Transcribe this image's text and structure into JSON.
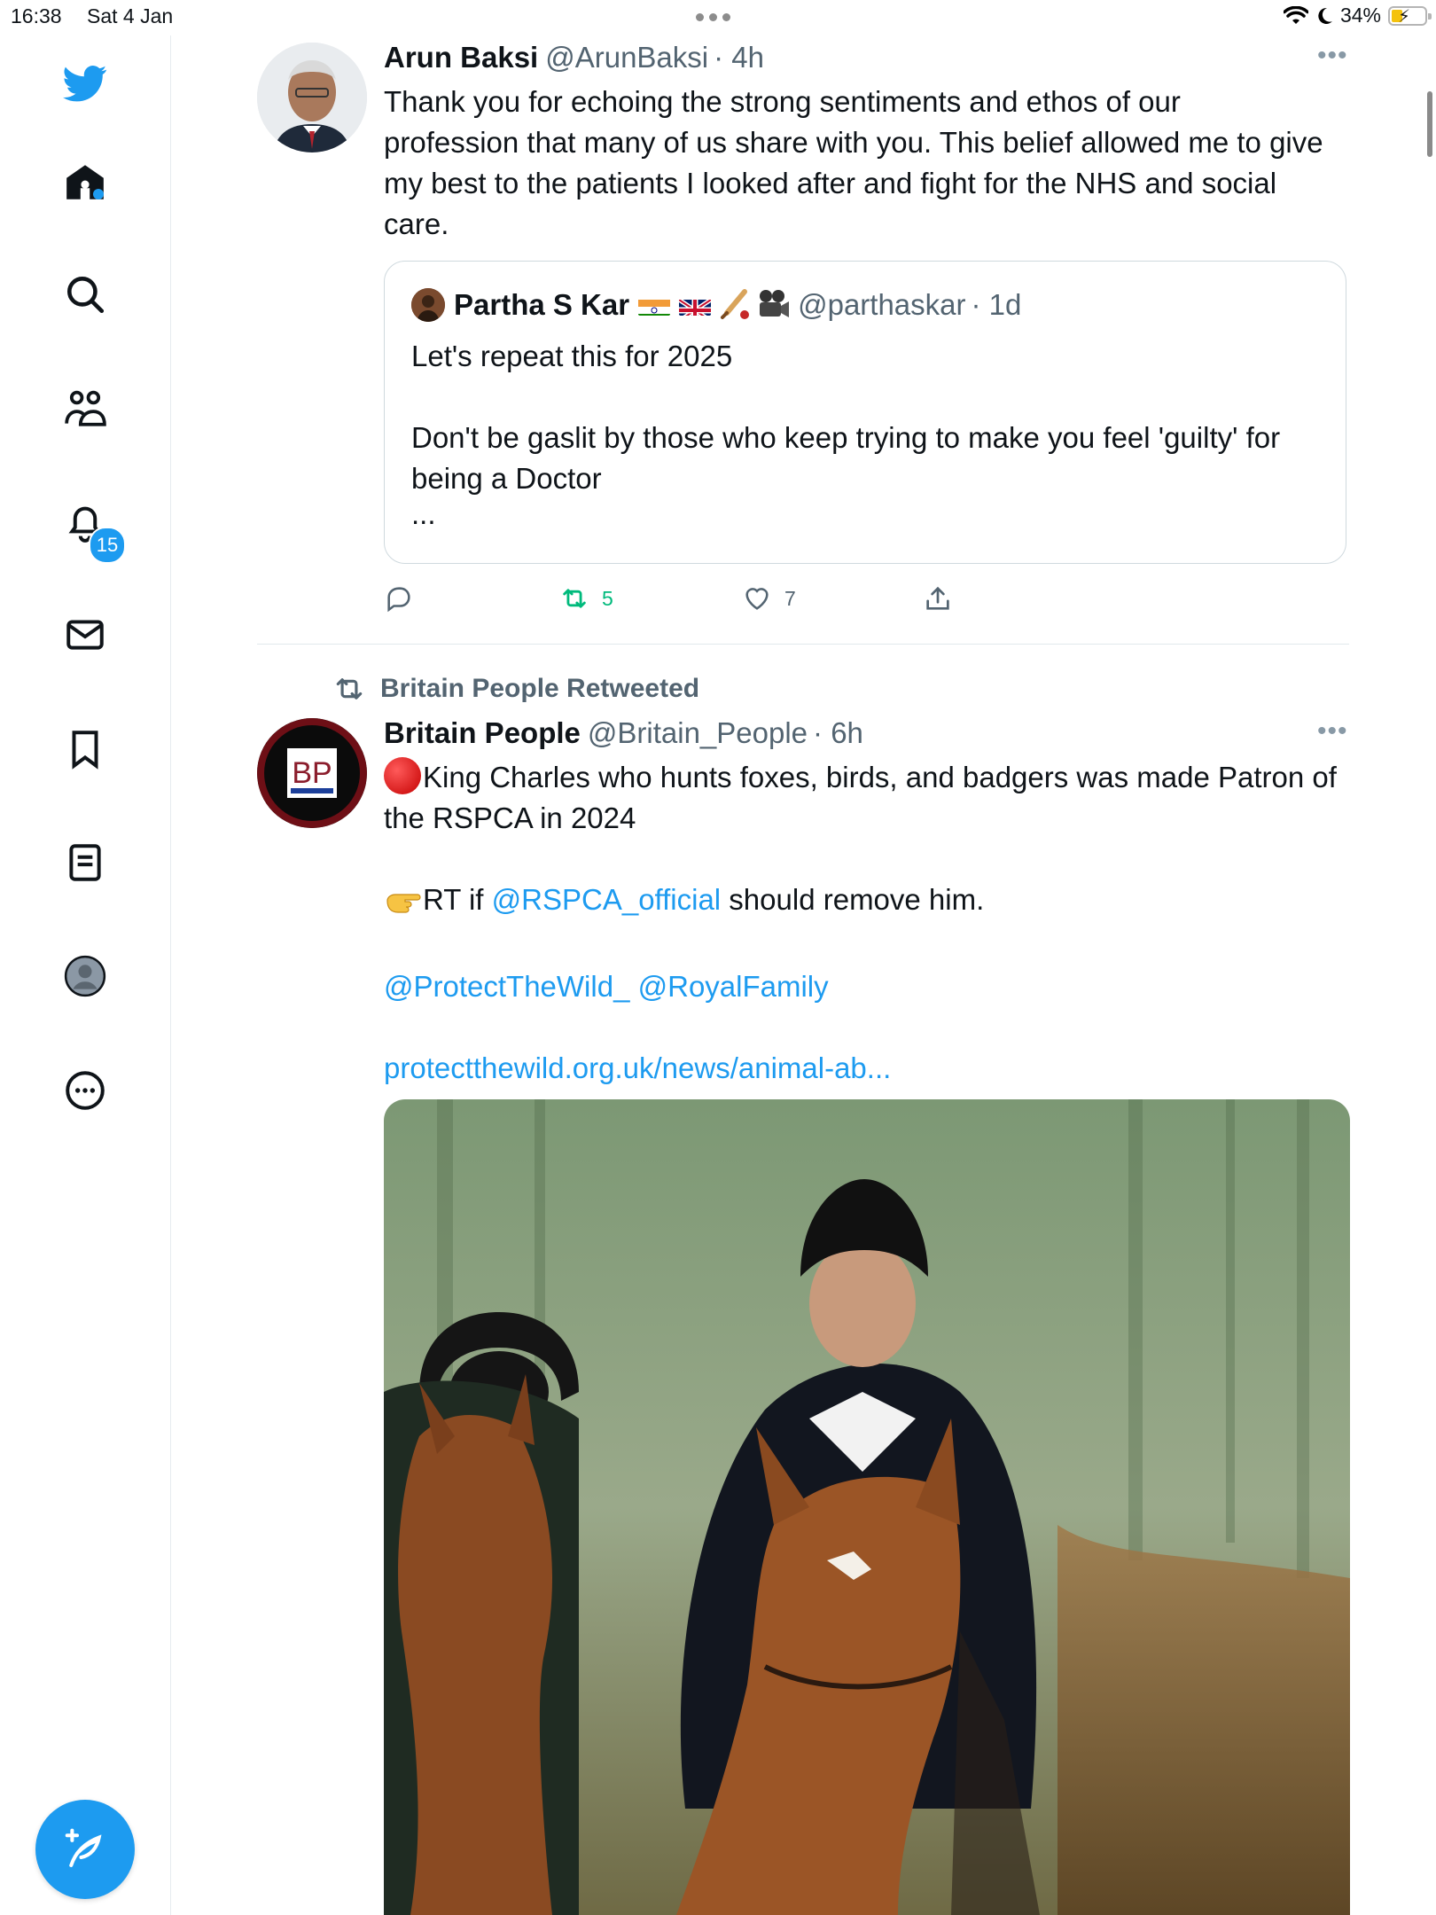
{
  "status_bar": {
    "time": "16:38",
    "date": "Sat 4 Jan",
    "battery": "34%",
    "battery_level": 0.34
  },
  "nav": {
    "items": [
      "twitter-logo",
      "home",
      "explore",
      "communities",
      "notifications",
      "messages",
      "bookmarks",
      "lists",
      "profile",
      "more"
    ],
    "notifications_badge": "15",
    "accent_color": "#1d9bf0"
  },
  "tweet1": {
    "name": "Arun Baksi",
    "handle": "@ArunBaksi",
    "time": "· 4h",
    "text": "Thank you for echoing the strong sentiments and ethos of our profession that many of us share with you. This belief allowed me to give my best to the patients I looked after and fight for the NHS and social care.",
    "quote": {
      "name": "Partha S Kar",
      "handle": "@parthaskar",
      "time": "· 1d",
      "line1": "Let's repeat this for 2025",
      "line2": "Don't be gaslit by those who keep trying to make you feel 'guilty' for being a Doctor",
      "ellipsis": "..."
    },
    "retweets": "5",
    "likes": "7"
  },
  "tweet2": {
    "retweeted_by": "Britain People Retweeted",
    "name": "Britain People",
    "handle": "@Britain_People",
    "time": "· 6h",
    "avatar_text": "BP",
    "line1": "King Charles who hunts foxes, birds, and badgers was made Patron of the RSPCA in 2024",
    "line2_prefix": "RT if ",
    "line2_mention": "@RSPCA_official",
    "line2_suffix": " should remove him.",
    "mention1": "@ProtectTheWild_",
    "mention2": "@RoyalFamily",
    "link": "protectthewild.org.uk/news/animal-ab..."
  }
}
